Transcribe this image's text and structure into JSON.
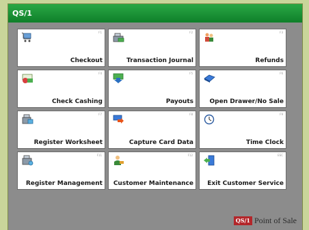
{
  "window": {
    "title": "QS/1"
  },
  "tiles": [
    {
      "label": "Checkout",
      "fkey": "F1",
      "icon": "shopping-cart-icon"
    },
    {
      "label": "Transaction Journal",
      "fkey": "F2",
      "icon": "cash-register-icon"
    },
    {
      "label": "Refunds",
      "fkey": "F3",
      "icon": "refund-people-icon"
    },
    {
      "label": "Check Cashing",
      "fkey": "F4",
      "icon": "check-money-icon"
    },
    {
      "label": "Payouts",
      "fkey": "F5",
      "icon": "payout-arrow-icon"
    },
    {
      "label": "Open Drawer/No Sale",
      "fkey": "F6",
      "icon": "cash-drawer-icon"
    },
    {
      "label": "Register Worksheet",
      "fkey": "F7",
      "icon": "worksheet-icon"
    },
    {
      "label": "Capture Card Data",
      "fkey": "F8",
      "icon": "card-capture-icon"
    },
    {
      "label": "Time Clock",
      "fkey": "F9",
      "icon": "clock-icon"
    },
    {
      "label": "Register Management",
      "fkey": "F11",
      "icon": "register-management-icon"
    },
    {
      "label": "Customer Maintenance",
      "fkey": "F12",
      "icon": "customer-icon"
    },
    {
      "label": "Exit Customer Service",
      "fkey": "ESC",
      "icon": "exit-door-icon"
    }
  ],
  "brand": {
    "logo": "QS/1",
    "text": "Point of Sale"
  }
}
